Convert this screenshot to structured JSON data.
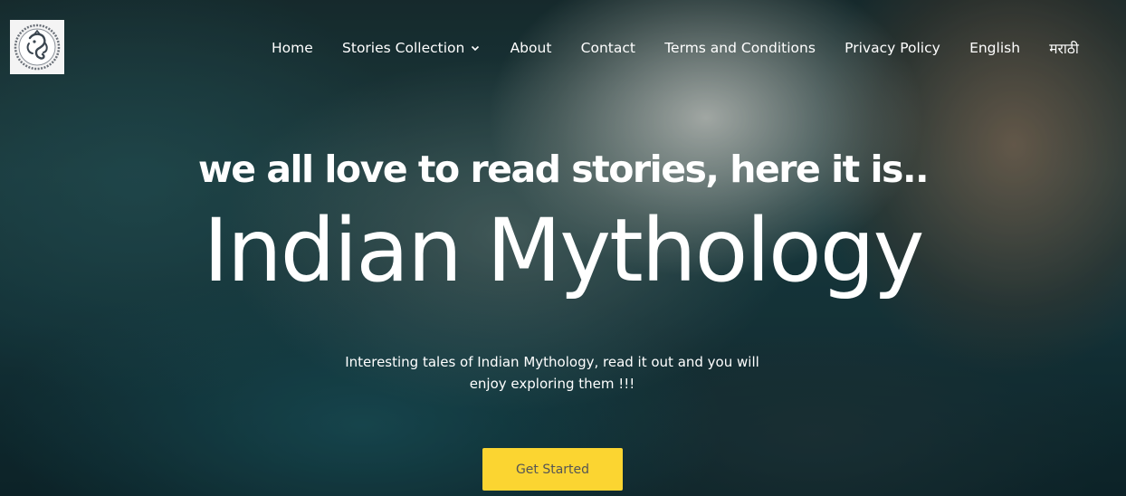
{
  "nav": {
    "items": [
      {
        "label": "Home"
      },
      {
        "label": "Stories Collection",
        "has_dropdown": true
      },
      {
        "label": "About"
      },
      {
        "label": "Contact"
      },
      {
        "label": "Terms and Conditions"
      },
      {
        "label": "Privacy Policy"
      },
      {
        "label": "English"
      },
      {
        "label": "मराठी"
      }
    ]
  },
  "hero": {
    "tagline": "we all love to read stories, here it is..",
    "title": "Indian Mythology",
    "description": "Interesting tales of Indian Mythology, read it out and you will enjoy exploring them !!!",
    "cta_label": "Get Started"
  },
  "colors": {
    "cta_background": "#fbd531",
    "cta_text": "#555555",
    "text": "#ffffff"
  },
  "icons": {
    "logo": "ganesha-logo-icon",
    "dropdown": "chevron-down-icon"
  }
}
